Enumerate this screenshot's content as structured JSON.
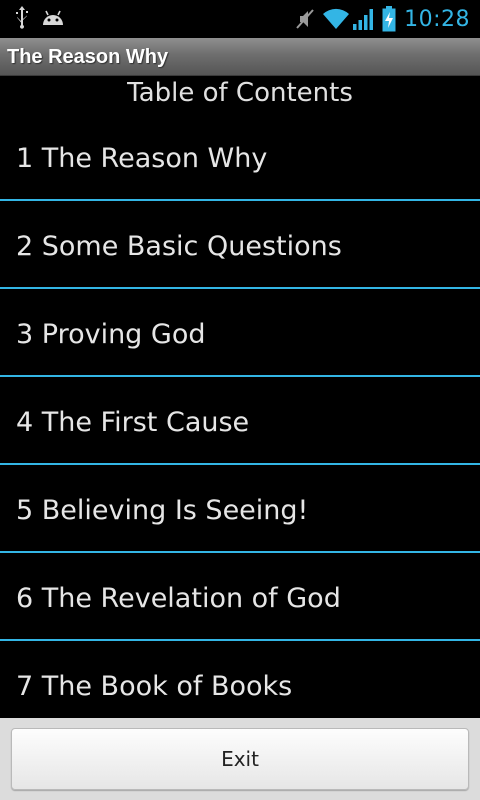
{
  "status_bar": {
    "time": "10:28",
    "icons": [
      "usb-icon",
      "android-debug-icon",
      "mute-icon",
      "wifi-icon",
      "signal-icon",
      "battery-charging-icon"
    ],
    "accent_color": "#33b5e5"
  },
  "title_bar": {
    "title": "The Reason Why"
  },
  "toc": {
    "heading": "Table of Contents",
    "items": [
      {
        "label": "1 The Reason Why"
      },
      {
        "label": "2 Some Basic Questions"
      },
      {
        "label": "3 Proving God"
      },
      {
        "label": "4 The First Cause"
      },
      {
        "label": "5 Believing Is Seeing!"
      },
      {
        "label": "6 The Revelation of God"
      },
      {
        "label": "7 The Book of Books"
      }
    ]
  },
  "footer": {
    "exit_label": "Exit"
  }
}
